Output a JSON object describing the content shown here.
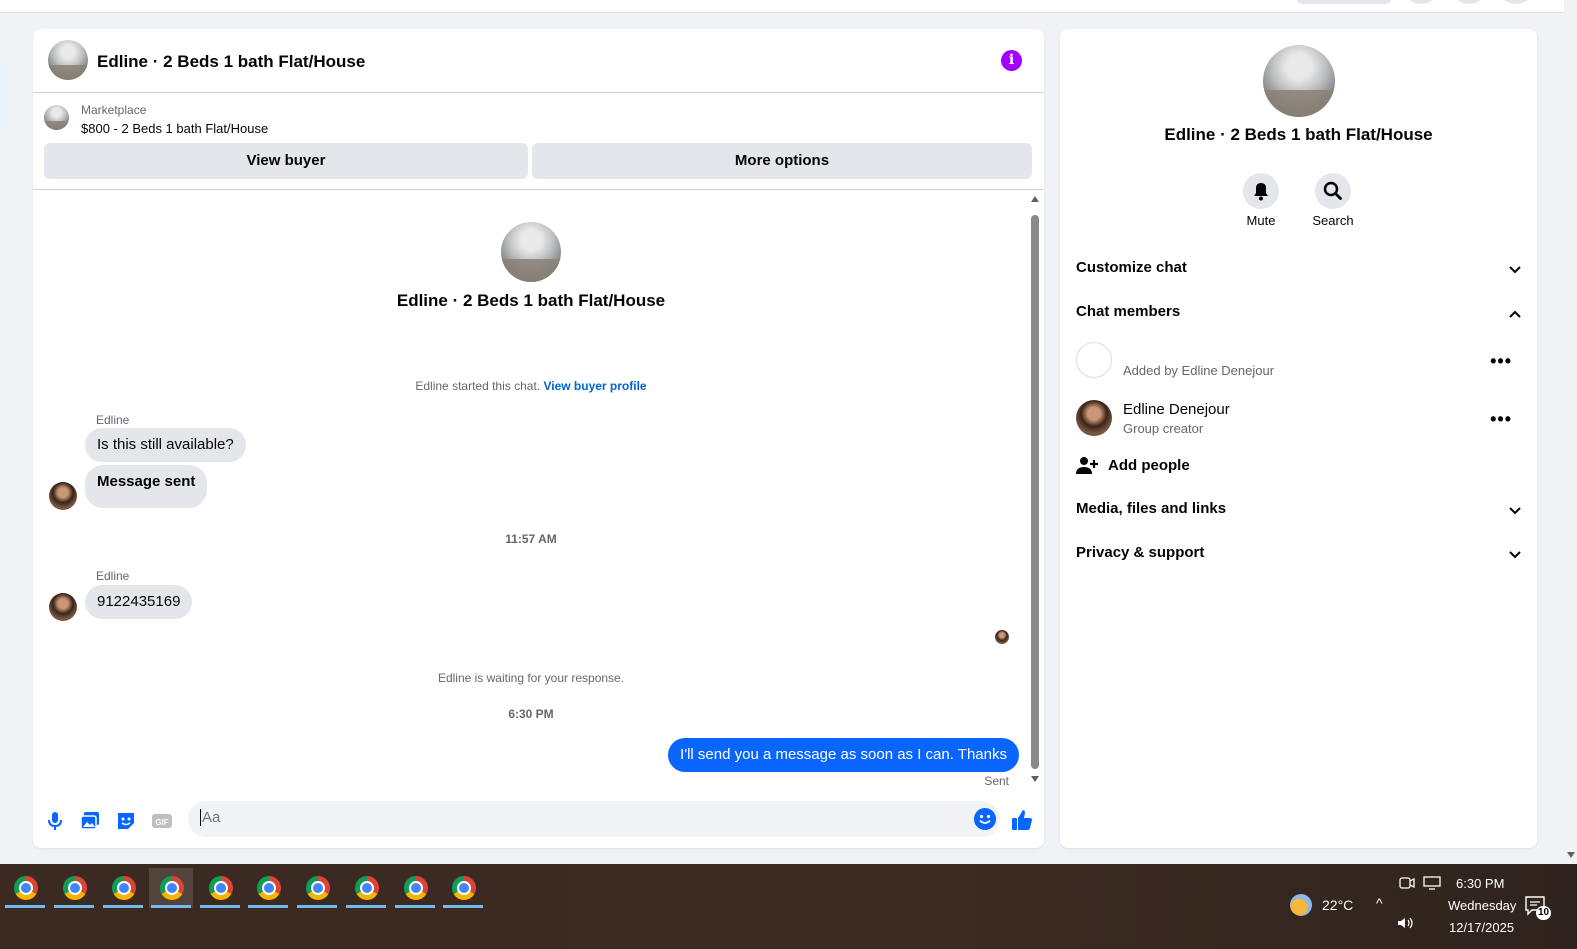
{
  "chat": {
    "title": "Edline · 2 Beds 1 bath Flat/House",
    "marketplace_label": "Marketplace",
    "listing": "$800 - 2 Beds 1 bath Flat/House",
    "view_buyer": "View buyer",
    "more_options": "More options",
    "intro_name": "Edline · 2 Beds 1 bath Flat/House",
    "started_text": "Edline started this chat.",
    "view_buyer_profile": "View buyer profile",
    "messages": [
      {
        "sender": "Edline",
        "text": "Is this still available?"
      },
      {
        "text": "Message sent"
      },
      {
        "timestamp": "11:57 AM"
      },
      {
        "sender": "Edline",
        "text": "9122435169"
      },
      {
        "note": "Edline is waiting for your response."
      },
      {
        "timestamp": "6:30 PM"
      },
      {
        "text": "I'll send you a message as soon as I can. Thanks",
        "status": "Sent"
      }
    ],
    "composer_placeholder": "Aa",
    "accent": "#0866ff",
    "info_color": "#a100ff"
  },
  "panel": {
    "title": "Edline · 2 Beds 1 bath Flat/House",
    "mute": "Mute",
    "search": "Search",
    "customize": "Customize chat",
    "members_heading": "Chat members",
    "members": [
      {
        "name": "",
        "sub": "Added by Edline Denejour"
      },
      {
        "name": "Edline Denejour",
        "sub": "Group creator"
      }
    ],
    "add_people": "Add people",
    "media": "Media, files and links",
    "privacy": "Privacy & support"
  },
  "taskbar": {
    "weather": "22°C",
    "time": "6:30 PM",
    "day": "Wednesday",
    "date": "12/17/2025",
    "notifications": "10"
  }
}
